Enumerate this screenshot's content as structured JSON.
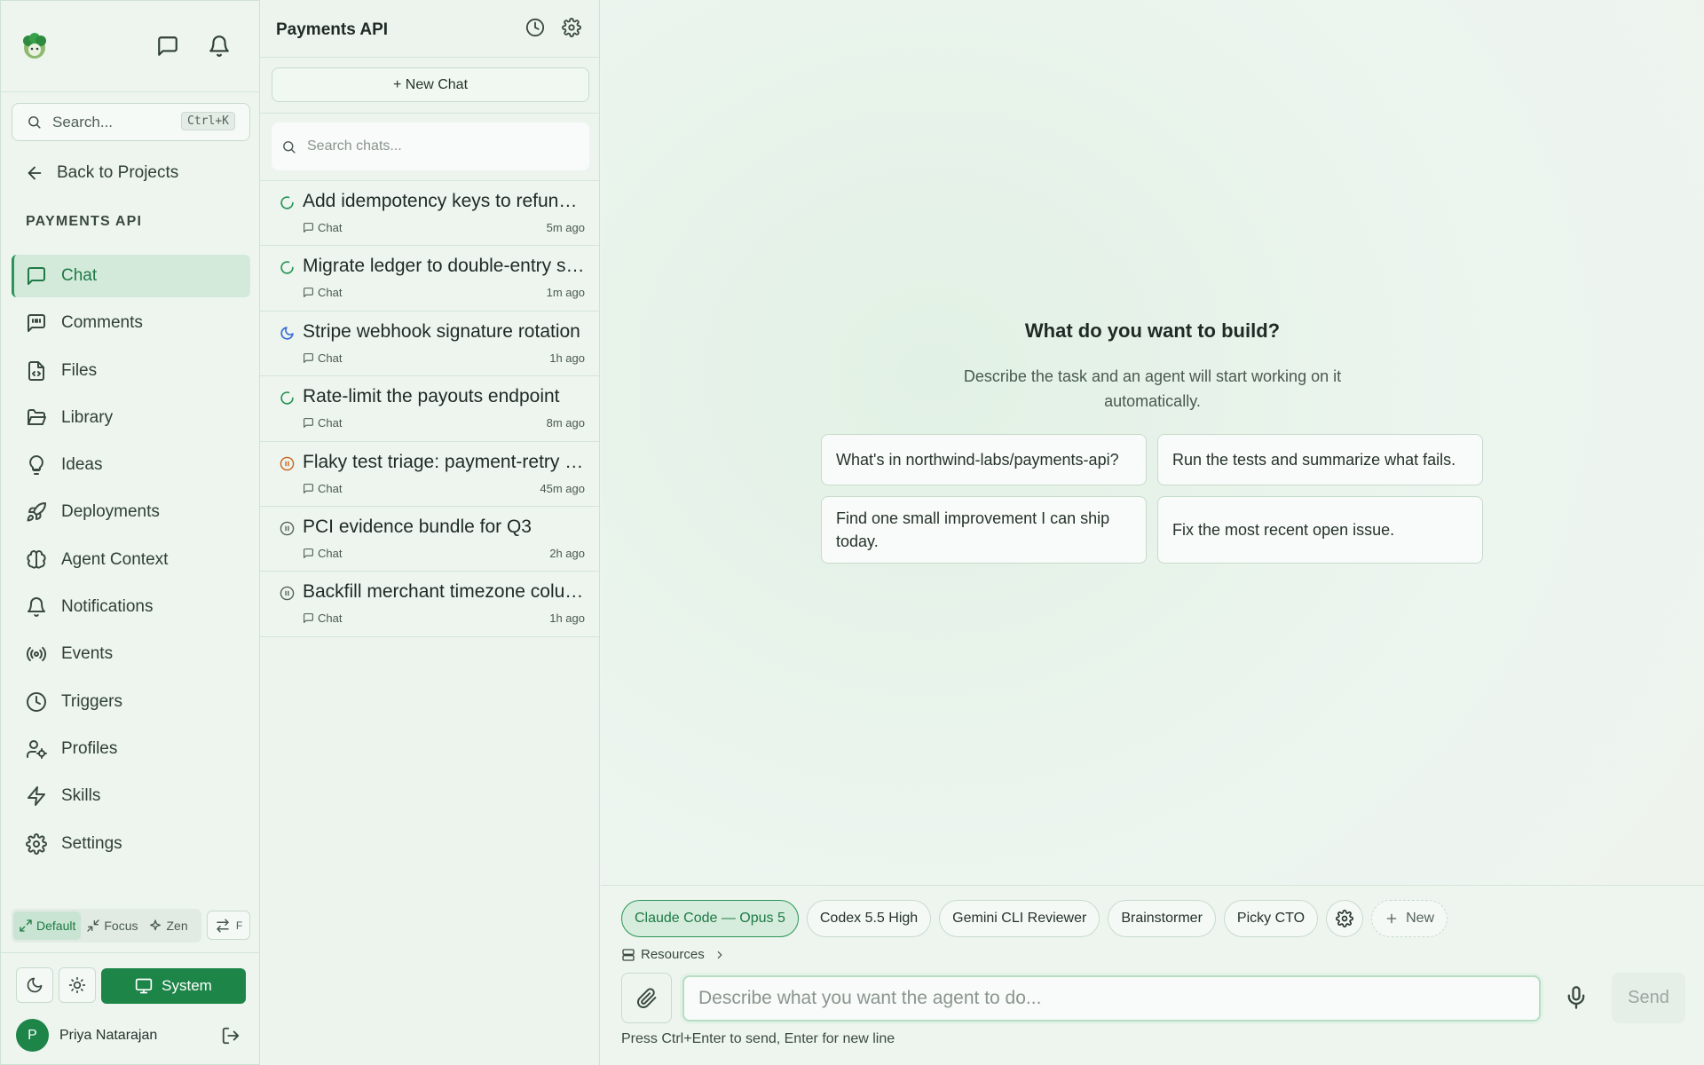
{
  "sidebar": {
    "search": {
      "placeholder": "Search...",
      "shortcut": "Ctrl+K"
    },
    "back_label": "Back to Projects",
    "section_title": "PAYMENTS API",
    "nav": [
      {
        "label": "Chat",
        "icon": "message-square-icon",
        "active": true
      },
      {
        "label": "Comments",
        "icon": "message-quote-icon"
      },
      {
        "label": "Files",
        "icon": "file-code-icon"
      },
      {
        "label": "Library",
        "icon": "folder-open-icon"
      },
      {
        "label": "Ideas",
        "icon": "lightbulb-icon"
      },
      {
        "label": "Deployments",
        "icon": "rocket-icon"
      },
      {
        "label": "Agent Context",
        "icon": "brain-icon"
      },
      {
        "label": "Notifications",
        "icon": "bell-icon"
      },
      {
        "label": "Events",
        "icon": "radio-icon"
      },
      {
        "label": "Triggers",
        "icon": "clock-icon"
      },
      {
        "label": "Profiles",
        "icon": "user-cog-icon"
      },
      {
        "label": "Skills",
        "icon": "zap-icon"
      },
      {
        "label": "Settings",
        "icon": "gear-icon"
      }
    ],
    "modes": {
      "default": "Default",
      "focus": "Focus",
      "zen": "Zen",
      "swap_key": "F"
    },
    "theme": {
      "system_label": "System"
    },
    "user": {
      "initial": "P",
      "name": "Priya Natarajan"
    }
  },
  "chatlist": {
    "title": "Payments API",
    "new_chat_label": "+ New Chat",
    "search_placeholder": "Search chats...",
    "chats": [
      {
        "title": "Add idempotency keys to refund endpoint",
        "type": "Chat",
        "time": "5m ago",
        "status": "running",
        "status_color": "#2a9556"
      },
      {
        "title": "Migrate ledger to double-entry schema",
        "type": "Chat",
        "time": "1m ago",
        "status": "running",
        "status_color": "#2a9556"
      },
      {
        "title": "Stripe webhook signature rotation",
        "type": "Chat",
        "time": "1h ago",
        "status": "idle",
        "status_color": "#3b6fd6"
      },
      {
        "title": "Rate-limit the payouts endpoint",
        "type": "Chat",
        "time": "8m ago",
        "status": "running",
        "status_color": "#2a9556"
      },
      {
        "title": "Flaky test triage: payment-retry worker",
        "type": "Chat",
        "time": "45m ago",
        "status": "paused",
        "status_color": "#c8641e"
      },
      {
        "title": "PCI evidence bundle for Q3",
        "type": "Chat",
        "time": "2h ago",
        "status": "paused",
        "status_color": "#55635a"
      },
      {
        "title": "Backfill merchant timezone column",
        "type": "Chat",
        "time": "1h ago",
        "status": "paused",
        "status_color": "#55635a"
      }
    ]
  },
  "main": {
    "hero_title": "What do you want to build?",
    "hero_subtitle": "Describe the task and an agent will start working on it automatically.",
    "suggestions": [
      "What's in northwind-labs/payments-api?",
      "Run the tests and summarize what fails.",
      "Find one small improvement I can ship today.",
      "Fix the most recent open issue."
    ],
    "agents": [
      "Claude Code — Opus 5",
      "Codex 5.5 High",
      "Gemini CLI Reviewer",
      "Brainstormer",
      "Picky CTO"
    ],
    "new_agent_label": "New",
    "resources_label": "Resources",
    "prompt_placeholder": "Describe what you want the agent to do...",
    "send_label": "Send",
    "hint": "Press Ctrl+Enter to send, Enter for new line"
  },
  "colors": {
    "accent": "#1e8549",
    "accent_light": "#d3eadb",
    "border": "#cfe2d4"
  }
}
